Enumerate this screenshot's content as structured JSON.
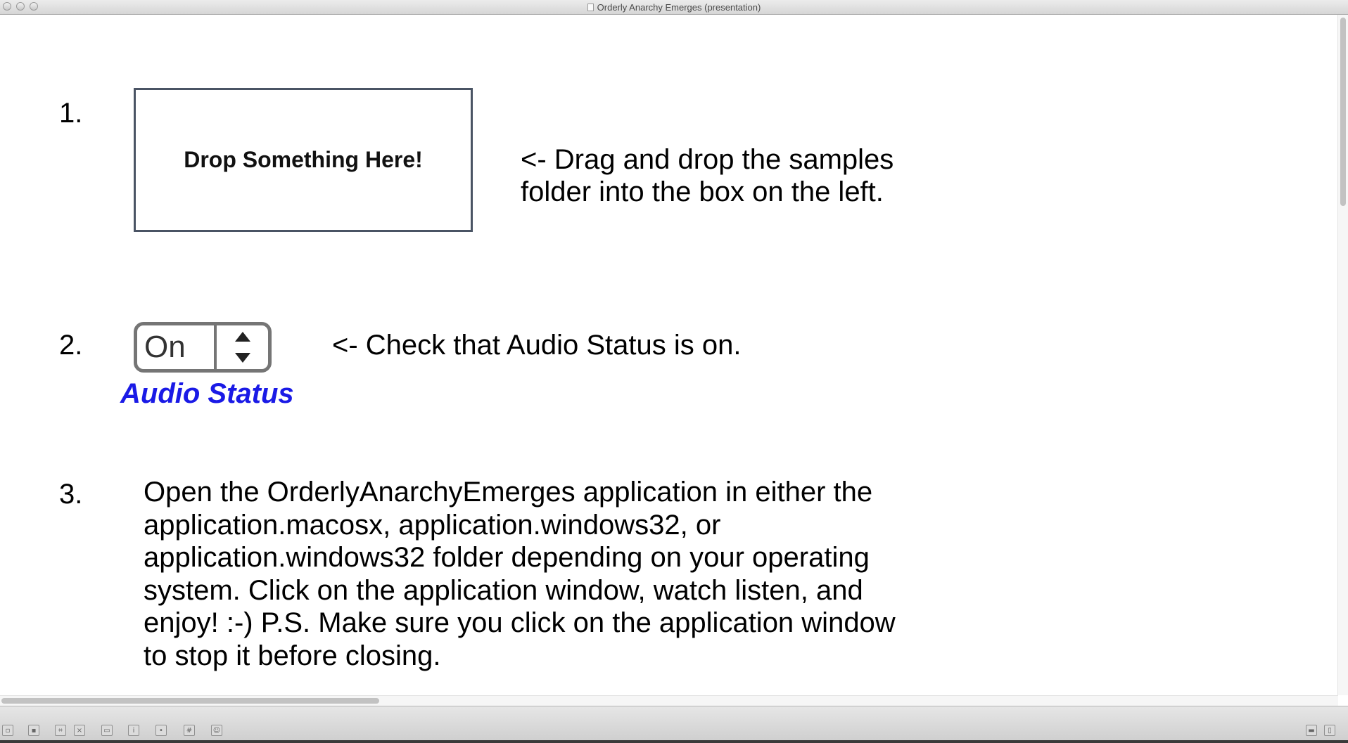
{
  "window": {
    "title": "Orderly Anarchy Emerges (presentation)"
  },
  "steps": [
    {
      "number": "1."
    },
    {
      "number": "2."
    },
    {
      "number": "3."
    }
  ],
  "drop_zone": {
    "label": "Drop Something Here!",
    "instruction_line1": "<- Drag and drop the samples",
    "instruction_line2": "folder into the box on the left."
  },
  "audio": {
    "value": "On",
    "label": "Audio Status",
    "label_color": "#1a1ae6",
    "instruction": "<- Check that Audio Status is on."
  },
  "step3": {
    "text": "Open the OrderlyAnarchyEmerges application in either the\napplication.macosx, application.windows32, or\napplication.windows32 folder depending on your operating\nsystem. Click on the application window, watch listen, and\nenjoy! :-) P.S. Make sure you click on the application window\nto stop it before closing."
  },
  "toolbar_icons": [
    "lock-icon",
    "edit-mode-icon",
    "patcher-icon",
    "delete-icon",
    "presentation-icon",
    "info-icon",
    "inspector-icon",
    "grid-icon",
    "clue-icon"
  ]
}
